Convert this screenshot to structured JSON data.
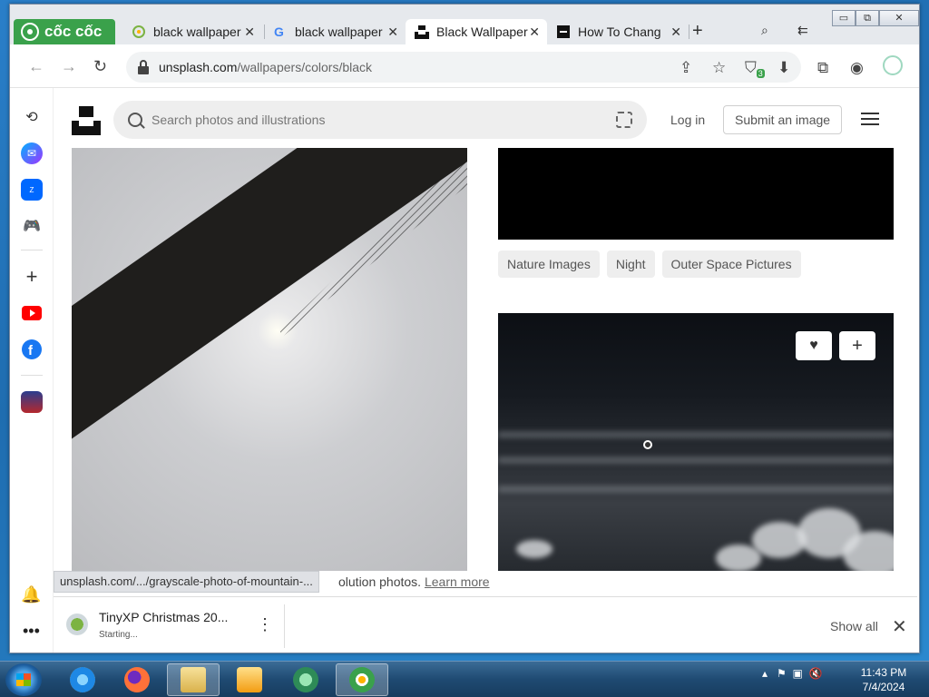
{
  "browser": {
    "brand": "cốc cốc",
    "tabs": [
      {
        "label": "black wallpaper",
        "active": false
      },
      {
        "label": "black wallpaper",
        "active": false
      },
      {
        "label": "Black Wallpaper",
        "active": true
      },
      {
        "label": "How To Chang",
        "active": false
      }
    ],
    "window_controls": {
      "minimize": "▭",
      "restore": "⧉",
      "close": "✕"
    },
    "url_host": "unsplash.com",
    "url_path": "/wallpapers/colors/black",
    "extension_badge": "3"
  },
  "page": {
    "search_placeholder": "Search photos and illustrations",
    "login": "Log in",
    "submit": "Submit an image",
    "tags": [
      "Nature Images",
      "Night",
      "Outer Space Pictures"
    ],
    "status_url": "unsplash.com/.../grayscale-photo-of-mountain-...",
    "status_text": "olution photos.",
    "learn_more": "Learn more"
  },
  "download": {
    "name": "TinyXP Christmas 20...",
    "state": "Starting...",
    "show_all": "Show all"
  },
  "taskbar": {
    "time": "11:43 PM",
    "date": "7/4/2024"
  },
  "colors": {
    "coccoc_green": "#3aa14b",
    "youtube_red": "#ff0000",
    "facebook_blue": "#1877f2"
  }
}
